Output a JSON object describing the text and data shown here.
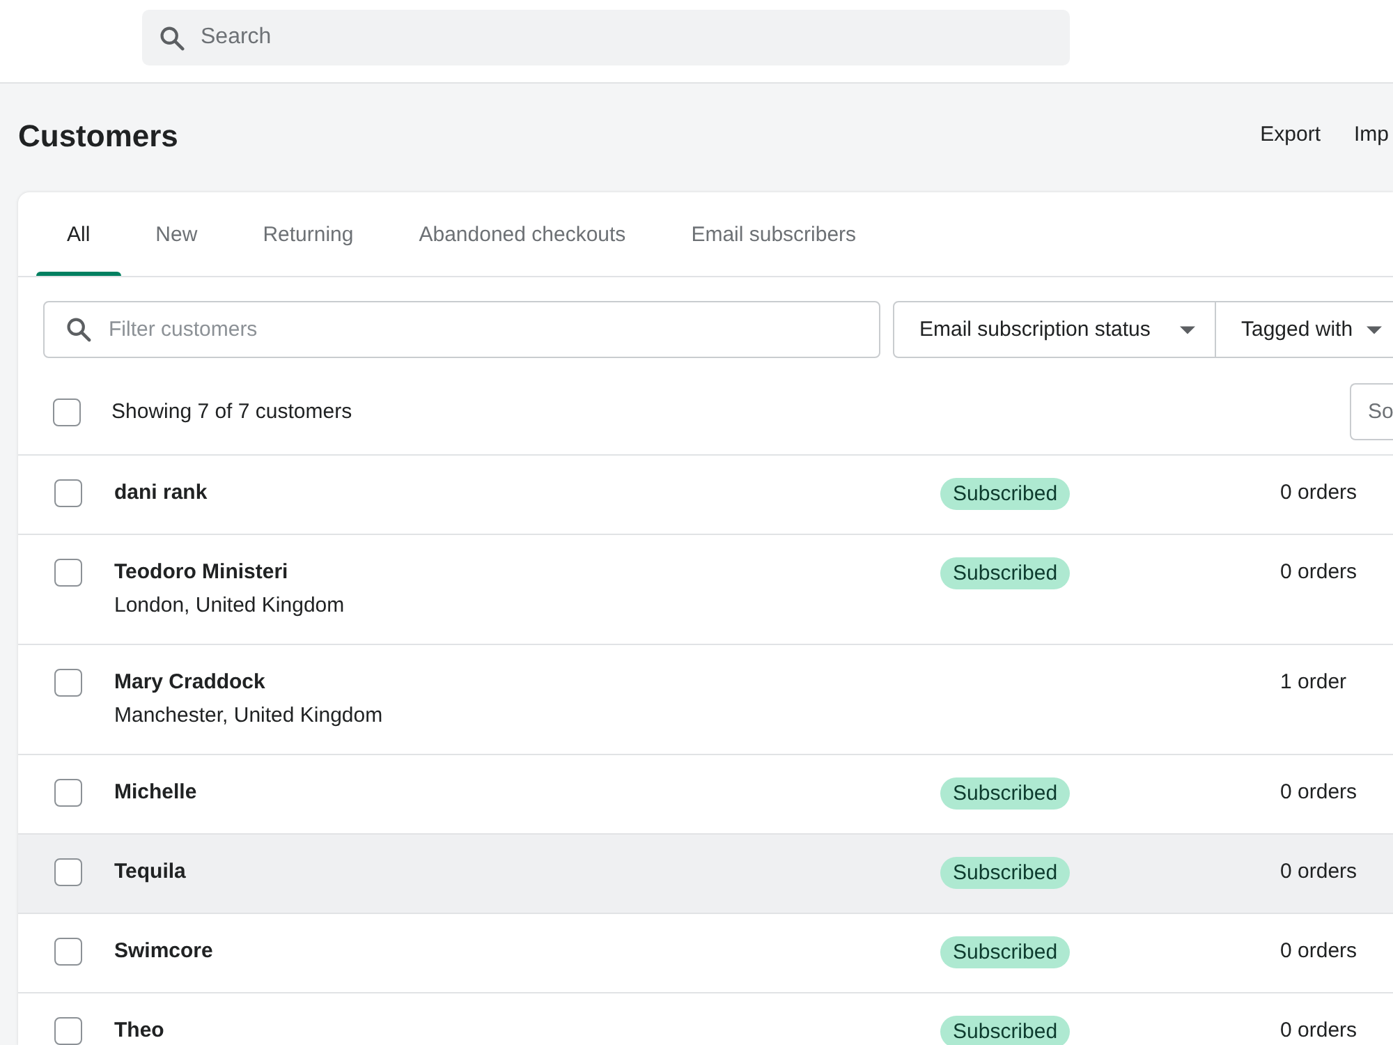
{
  "top_bar": {
    "search": {
      "placeholder": "Search"
    }
  },
  "header": {
    "title": "Customers",
    "actions": [
      "Export",
      "Imp"
    ]
  },
  "tabs": [
    {
      "label": "All",
      "selected": true
    },
    {
      "label": "New",
      "selected": false
    },
    {
      "label": "Returning",
      "selected": false
    },
    {
      "label": "Abandoned checkouts",
      "selected": false
    },
    {
      "label": "Email subscribers",
      "selected": false
    }
  ],
  "filter": {
    "placeholder": "Filter customers",
    "buttons": [
      "Email subscription status",
      "Tagged with"
    ]
  },
  "list_header": {
    "checked": false,
    "summary": "Showing 7 of 7 customers",
    "sort_button": "So"
  },
  "customers": [
    {
      "name": "dani rank",
      "checked": false,
      "highlighted": false,
      "badge": "Subscribed",
      "orders": "0 orders"
    },
    {
      "name": "Teodoro Ministeri",
      "location": "London, United Kingdom",
      "checked": false,
      "highlighted": false,
      "badge": "Subscribed",
      "orders": "0 orders"
    },
    {
      "name": "Mary Craddock",
      "location": "Manchester, United Kingdom",
      "checked": false,
      "highlighted": false,
      "orders": "1 order"
    },
    {
      "name": "Michelle",
      "checked": false,
      "highlighted": false,
      "badge": "Subscribed",
      "orders": "0 orders"
    },
    {
      "name": "Tequila",
      "checked": false,
      "highlighted": true,
      "badge": "Subscribed",
      "orders": "0 orders"
    },
    {
      "name": "Swimcore",
      "checked": false,
      "highlighted": false,
      "badge": "Subscribed",
      "orders": "0 orders"
    },
    {
      "name": "Theo",
      "checked": false,
      "highlighted": false,
      "badge": "Subscribed",
      "orders": "0 orders"
    }
  ]
}
